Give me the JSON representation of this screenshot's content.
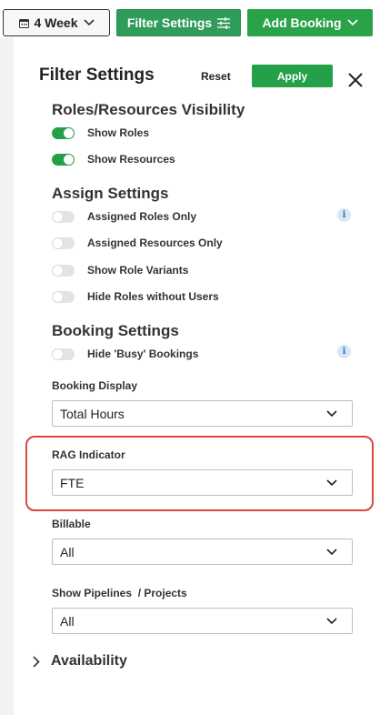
{
  "toolbar": {
    "week_label": "4 Week",
    "filter_label": "Filter Settings",
    "add_booking_label": "Add Booking"
  },
  "panel": {
    "title": "Filter Settings",
    "reset_label": "Reset",
    "apply_label": "Apply"
  },
  "visibility": {
    "title": "Roles/Resources Visibility",
    "items": [
      {
        "label": "Show Roles",
        "on": true
      },
      {
        "label": "Show Resources",
        "on": true
      }
    ]
  },
  "assign": {
    "title": "Assign Settings",
    "items": [
      {
        "label": "Assigned Roles Only",
        "on": false
      },
      {
        "label": "Assigned Resources Only",
        "on": false
      },
      {
        "label": "Show Role Variants",
        "on": false
      },
      {
        "label": "Hide Roles without Users",
        "on": false
      }
    ]
  },
  "booking": {
    "title": "Booking Settings",
    "items": [
      {
        "label": "Hide 'Busy' Bookings",
        "on": false
      }
    ]
  },
  "fields": {
    "booking_display": {
      "label": "Booking Display",
      "value": "Total Hours"
    },
    "rag_indicator": {
      "label": "RAG Indicator",
      "value": "FTE"
    },
    "billable": {
      "label": "Billable",
      "value": "All"
    },
    "pipelines": {
      "label": "Show Pipelines  / Projects",
      "value": "All"
    }
  },
  "availability": {
    "label": "Availability"
  },
  "colors": {
    "accent": "#24a148",
    "highlight": "#d44a3c",
    "info": "#3a6fb0"
  }
}
